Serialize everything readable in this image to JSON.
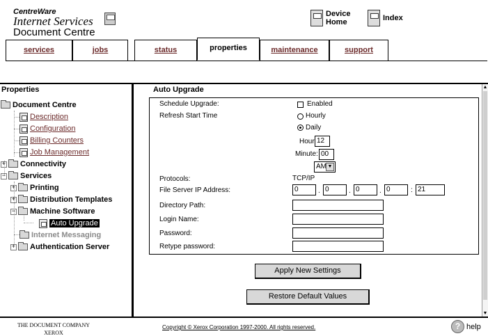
{
  "header": {
    "brand_line1": "CentreWare",
    "brand_line2": "Internet Services",
    "brand_line3": "Document Centre",
    "device_home_line1": "Device",
    "device_home_line2": "Home",
    "index_label": "Index"
  },
  "tabs": [
    {
      "label": "services",
      "active": false
    },
    {
      "label": "jobs",
      "active": false
    },
    {
      "label": "status",
      "active": false
    },
    {
      "label": "properties",
      "active": true
    },
    {
      "label": "maintenance",
      "active": false
    },
    {
      "label": "support",
      "active": false
    }
  ],
  "sidebar": {
    "title": "Properties",
    "root": "Document Centre",
    "items": {
      "description": "Description",
      "configuration": "Configuration",
      "billing_counters": "Billing Counters",
      "job_management": "Job Management",
      "connectivity": "Connectivity",
      "services": "Services",
      "printing": "Printing",
      "distribution_templates": "Distribution Templates",
      "machine_software": "Machine Software",
      "auto_upgrade": "Auto Upgrade",
      "internet_messaging": "Internet Messaging",
      "authentication_server": "Authentication Server"
    },
    "selected": "Auto Upgrade"
  },
  "main": {
    "title": "Auto Upgrade",
    "labels": {
      "schedule_upgrade": "Schedule Upgrade:",
      "refresh_start_time": "Refresh Start Time",
      "protocols": "Protocols:",
      "file_server_ip": "File Server IP Address:",
      "directory_path": "Directory Path:",
      "login_name": "Login Name:",
      "password": "Password:",
      "retype_password": "Retype password:"
    },
    "enabled_label": "Enabled",
    "enabled_checked": false,
    "hourly_label": "Hourly",
    "daily_label": "Daily",
    "refresh_selected": "Daily",
    "hour_label": "Hour:",
    "hour_value": "12",
    "minute_label": "Minute:",
    "minute_value": "00",
    "ampm_value": "AM",
    "protocol_value": "TCP/IP",
    "ip_octets": [
      "0",
      "0",
      "0",
      "0"
    ],
    "ip_dot": ".",
    "port_separator": ":",
    "port_value": "21",
    "directory_path_value": "",
    "login_name_value": "",
    "password_value": "",
    "retype_password_value": "",
    "apply_button": "Apply New Settings",
    "restore_button": "Restore Default Values"
  },
  "footer": {
    "company_line1": "THE DOCUMENT COMPANY",
    "company_line2": "XEROX",
    "copyright": "Copyright © Xerox Corporation 1997-2000. All rights reserved.",
    "help_label": "help",
    "help_icon_glyph": "?"
  },
  "icons": {
    "scroll_up": "▲",
    "scroll_down": "▼",
    "dropdown_arrow": "▼",
    "expand": "+",
    "collapse": "−"
  }
}
